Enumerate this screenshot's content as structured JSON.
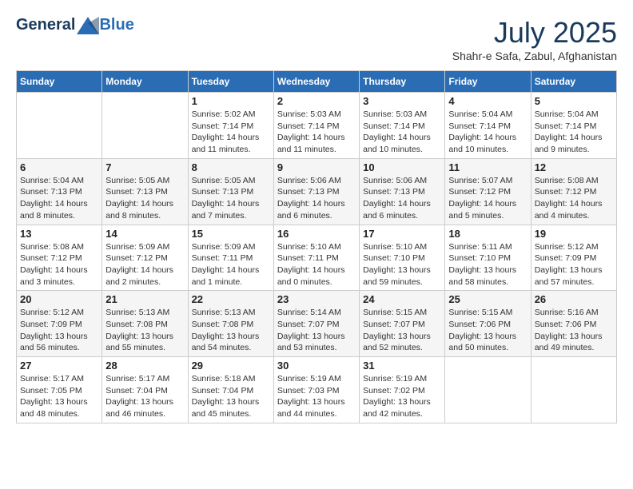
{
  "header": {
    "logo_line1": "General",
    "logo_line2": "Blue",
    "month_year": "July 2025",
    "location": "Shahr-e Safa, Zabul, Afghanistan"
  },
  "days_of_week": [
    "Sunday",
    "Monday",
    "Tuesday",
    "Wednesday",
    "Thursday",
    "Friday",
    "Saturday"
  ],
  "weeks": [
    [
      {
        "day": "",
        "sunrise": "",
        "sunset": "",
        "daylight": ""
      },
      {
        "day": "",
        "sunrise": "",
        "sunset": "",
        "daylight": ""
      },
      {
        "day": "1",
        "sunrise": "Sunrise: 5:02 AM",
        "sunset": "Sunset: 7:14 PM",
        "daylight": "Daylight: 14 hours and 11 minutes."
      },
      {
        "day": "2",
        "sunrise": "Sunrise: 5:03 AM",
        "sunset": "Sunset: 7:14 PM",
        "daylight": "Daylight: 14 hours and 11 minutes."
      },
      {
        "day": "3",
        "sunrise": "Sunrise: 5:03 AM",
        "sunset": "Sunset: 7:14 PM",
        "daylight": "Daylight: 14 hours and 10 minutes."
      },
      {
        "day": "4",
        "sunrise": "Sunrise: 5:04 AM",
        "sunset": "Sunset: 7:14 PM",
        "daylight": "Daylight: 14 hours and 10 minutes."
      },
      {
        "day": "5",
        "sunrise": "Sunrise: 5:04 AM",
        "sunset": "Sunset: 7:14 PM",
        "daylight": "Daylight: 14 hours and 9 minutes."
      }
    ],
    [
      {
        "day": "6",
        "sunrise": "Sunrise: 5:04 AM",
        "sunset": "Sunset: 7:13 PM",
        "daylight": "Daylight: 14 hours and 8 minutes."
      },
      {
        "day": "7",
        "sunrise": "Sunrise: 5:05 AM",
        "sunset": "Sunset: 7:13 PM",
        "daylight": "Daylight: 14 hours and 8 minutes."
      },
      {
        "day": "8",
        "sunrise": "Sunrise: 5:05 AM",
        "sunset": "Sunset: 7:13 PM",
        "daylight": "Daylight: 14 hours and 7 minutes."
      },
      {
        "day": "9",
        "sunrise": "Sunrise: 5:06 AM",
        "sunset": "Sunset: 7:13 PM",
        "daylight": "Daylight: 14 hours and 6 minutes."
      },
      {
        "day": "10",
        "sunrise": "Sunrise: 5:06 AM",
        "sunset": "Sunset: 7:13 PM",
        "daylight": "Daylight: 14 hours and 6 minutes."
      },
      {
        "day": "11",
        "sunrise": "Sunrise: 5:07 AM",
        "sunset": "Sunset: 7:12 PM",
        "daylight": "Daylight: 14 hours and 5 minutes."
      },
      {
        "day": "12",
        "sunrise": "Sunrise: 5:08 AM",
        "sunset": "Sunset: 7:12 PM",
        "daylight": "Daylight: 14 hours and 4 minutes."
      }
    ],
    [
      {
        "day": "13",
        "sunrise": "Sunrise: 5:08 AM",
        "sunset": "Sunset: 7:12 PM",
        "daylight": "Daylight: 14 hours and 3 minutes."
      },
      {
        "day": "14",
        "sunrise": "Sunrise: 5:09 AM",
        "sunset": "Sunset: 7:12 PM",
        "daylight": "Daylight: 14 hours and 2 minutes."
      },
      {
        "day": "15",
        "sunrise": "Sunrise: 5:09 AM",
        "sunset": "Sunset: 7:11 PM",
        "daylight": "Daylight: 14 hours and 1 minute."
      },
      {
        "day": "16",
        "sunrise": "Sunrise: 5:10 AM",
        "sunset": "Sunset: 7:11 PM",
        "daylight": "Daylight: 14 hours and 0 minutes."
      },
      {
        "day": "17",
        "sunrise": "Sunrise: 5:10 AM",
        "sunset": "Sunset: 7:10 PM",
        "daylight": "Daylight: 13 hours and 59 minutes."
      },
      {
        "day": "18",
        "sunrise": "Sunrise: 5:11 AM",
        "sunset": "Sunset: 7:10 PM",
        "daylight": "Daylight: 13 hours and 58 minutes."
      },
      {
        "day": "19",
        "sunrise": "Sunrise: 5:12 AM",
        "sunset": "Sunset: 7:09 PM",
        "daylight": "Daylight: 13 hours and 57 minutes."
      }
    ],
    [
      {
        "day": "20",
        "sunrise": "Sunrise: 5:12 AM",
        "sunset": "Sunset: 7:09 PM",
        "daylight": "Daylight: 13 hours and 56 minutes."
      },
      {
        "day": "21",
        "sunrise": "Sunrise: 5:13 AM",
        "sunset": "Sunset: 7:08 PM",
        "daylight": "Daylight: 13 hours and 55 minutes."
      },
      {
        "day": "22",
        "sunrise": "Sunrise: 5:13 AM",
        "sunset": "Sunset: 7:08 PM",
        "daylight": "Daylight: 13 hours and 54 minutes."
      },
      {
        "day": "23",
        "sunrise": "Sunrise: 5:14 AM",
        "sunset": "Sunset: 7:07 PM",
        "daylight": "Daylight: 13 hours and 53 minutes."
      },
      {
        "day": "24",
        "sunrise": "Sunrise: 5:15 AM",
        "sunset": "Sunset: 7:07 PM",
        "daylight": "Daylight: 13 hours and 52 minutes."
      },
      {
        "day": "25",
        "sunrise": "Sunrise: 5:15 AM",
        "sunset": "Sunset: 7:06 PM",
        "daylight": "Daylight: 13 hours and 50 minutes."
      },
      {
        "day": "26",
        "sunrise": "Sunrise: 5:16 AM",
        "sunset": "Sunset: 7:06 PM",
        "daylight": "Daylight: 13 hours and 49 minutes."
      }
    ],
    [
      {
        "day": "27",
        "sunrise": "Sunrise: 5:17 AM",
        "sunset": "Sunset: 7:05 PM",
        "daylight": "Daylight: 13 hours and 48 minutes."
      },
      {
        "day": "28",
        "sunrise": "Sunrise: 5:17 AM",
        "sunset": "Sunset: 7:04 PM",
        "daylight": "Daylight: 13 hours and 46 minutes."
      },
      {
        "day": "29",
        "sunrise": "Sunrise: 5:18 AM",
        "sunset": "Sunset: 7:04 PM",
        "daylight": "Daylight: 13 hours and 45 minutes."
      },
      {
        "day": "30",
        "sunrise": "Sunrise: 5:19 AM",
        "sunset": "Sunset: 7:03 PM",
        "daylight": "Daylight: 13 hours and 44 minutes."
      },
      {
        "day": "31",
        "sunrise": "Sunrise: 5:19 AM",
        "sunset": "Sunset: 7:02 PM",
        "daylight": "Daylight: 13 hours and 42 minutes."
      },
      {
        "day": "",
        "sunrise": "",
        "sunset": "",
        "daylight": ""
      },
      {
        "day": "",
        "sunrise": "",
        "sunset": "",
        "daylight": ""
      }
    ]
  ]
}
